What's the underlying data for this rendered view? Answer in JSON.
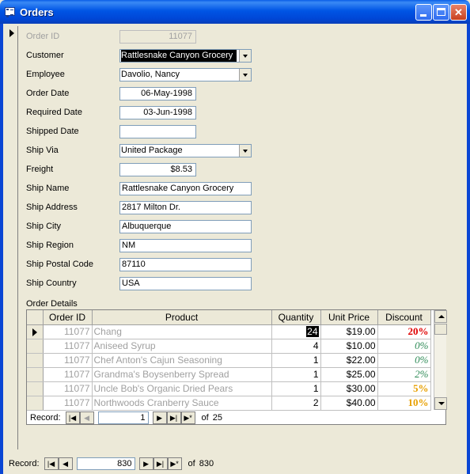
{
  "window": {
    "title": "Orders"
  },
  "form": {
    "fields": [
      {
        "key": "order_id",
        "label": "Order ID",
        "value": "11077",
        "disabled": true
      },
      {
        "key": "customer",
        "label": "Customer",
        "value": "Rattlesnake Canyon Grocery",
        "type": "combo"
      },
      {
        "key": "employee",
        "label": "Employee",
        "value": "Davolio, Nancy",
        "type": "combo"
      },
      {
        "key": "order_date",
        "label": "Order Date",
        "value": "06-May-1998"
      },
      {
        "key": "required_date",
        "label": "Required Date",
        "value": "03-Jun-1998"
      },
      {
        "key": "shipped_date",
        "label": "Shipped Date",
        "value": ""
      },
      {
        "key": "ship_via",
        "label": "Ship Via",
        "value": "United Package",
        "type": "combo"
      },
      {
        "key": "freight",
        "label": "Freight",
        "value": "$8.53"
      },
      {
        "key": "ship_name",
        "label": "Ship Name",
        "value": "Rattlesnake Canyon Grocery"
      },
      {
        "key": "ship_address",
        "label": "Ship Address",
        "value": "2817 Milton Dr."
      },
      {
        "key": "ship_city",
        "label": "Ship City",
        "value": "Albuquerque"
      },
      {
        "key": "ship_region",
        "label": "Ship Region",
        "value": "NM"
      },
      {
        "key": "ship_postal_code",
        "label": "Ship Postal Code",
        "value": "87110"
      },
      {
        "key": "ship_country",
        "label": "Ship Country",
        "value": "USA"
      }
    ]
  },
  "order_details": {
    "title": "Order Details",
    "columns": [
      "Order ID",
      "Product",
      "Quantity",
      "Unit Price",
      "Discount"
    ],
    "rows": [
      {
        "order_id": "11077",
        "product": "Chang",
        "quantity": "24",
        "unit_price": "$19.00",
        "discount": "20%",
        "discount_color": "#e00000",
        "discount_bold": true
      },
      {
        "order_id": "11077",
        "product": "Aniseed Syrup",
        "quantity": "4",
        "unit_price": "$10.00",
        "discount": "0%",
        "discount_color": "#2e8b57",
        "discount_bold": false
      },
      {
        "order_id": "11077",
        "product": "Chef Anton's Cajun Seasoning",
        "quantity": "1",
        "unit_price": "$22.00",
        "discount": "0%",
        "discount_color": "#2e8b57",
        "discount_bold": false
      },
      {
        "order_id": "11077",
        "product": "Grandma's Boysenberry Spread",
        "quantity": "1",
        "unit_price": "$25.00",
        "discount": "2%",
        "discount_color": "#2e8b57",
        "discount_bold": false
      },
      {
        "order_id": "11077",
        "product": "Uncle Bob's Organic Dried Pears",
        "quantity": "1",
        "unit_price": "$30.00",
        "discount": "5%",
        "discount_color": "#e8a000",
        "discount_bold": true
      },
      {
        "order_id": "11077",
        "product": "Northwoods Cranberry Sauce",
        "quantity": "2",
        "unit_price": "$40.00",
        "discount": "10%",
        "discount_color": "#e8a000",
        "discount_bold": true
      }
    ],
    "nav": {
      "label": "Record:",
      "current": "1",
      "of_label": "of",
      "total": "25"
    }
  },
  "main_nav": {
    "label": "Record:",
    "current": "830",
    "of_label": "of",
    "total": "830"
  }
}
